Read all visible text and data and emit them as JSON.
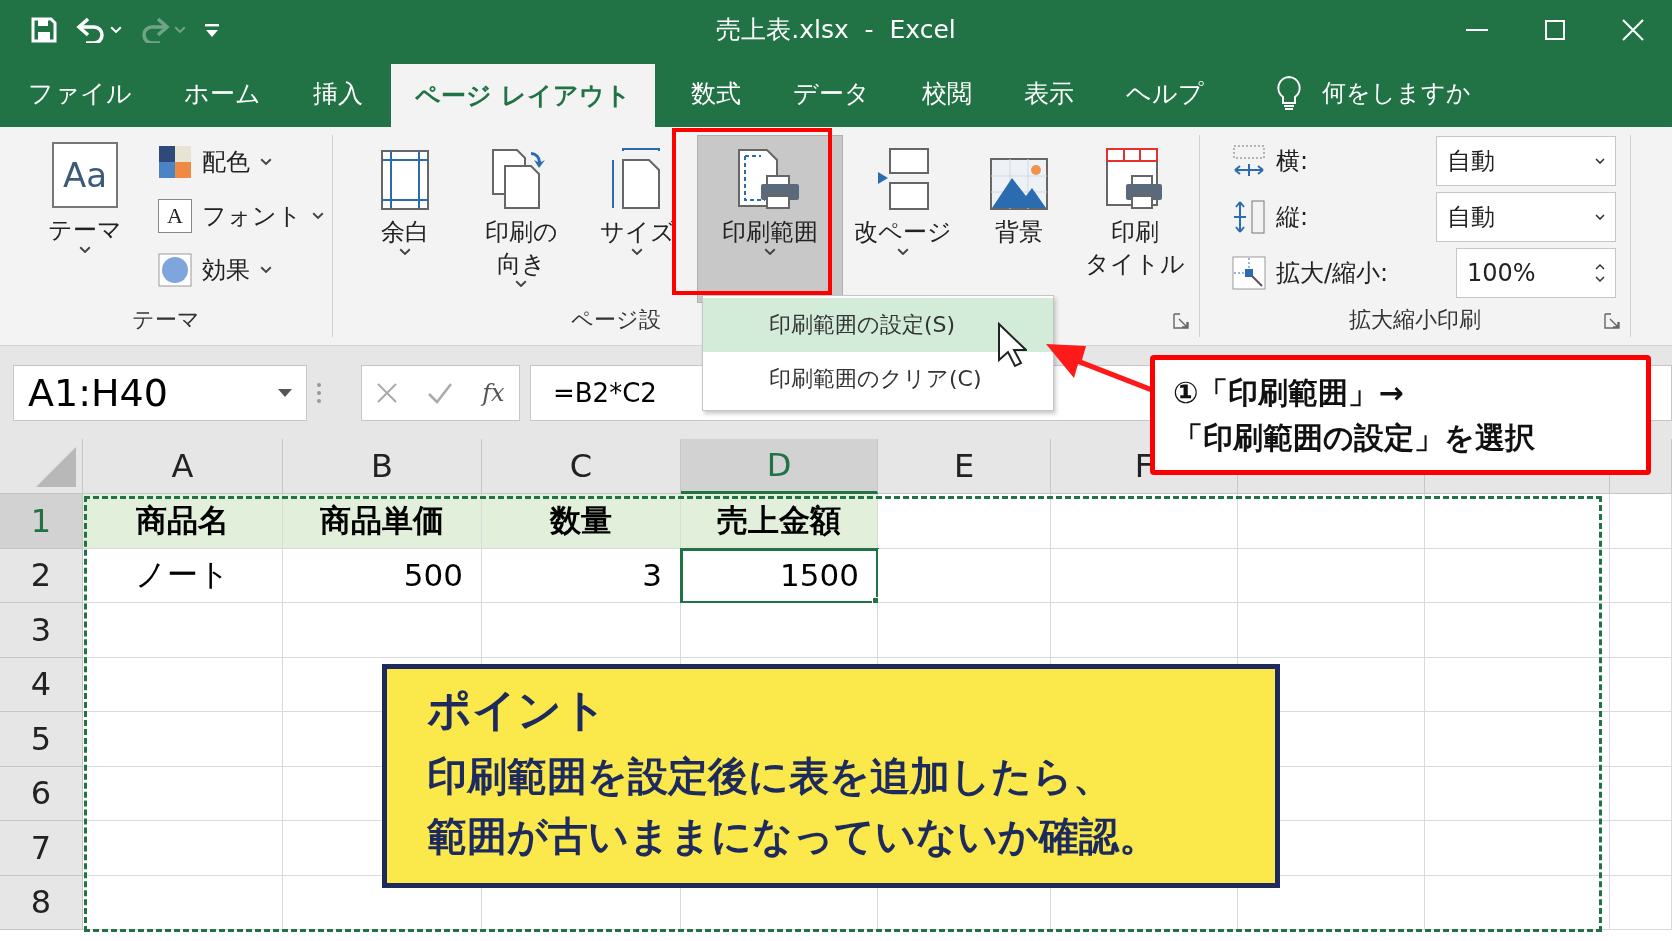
{
  "title_bar": {
    "title": "売上表.xlsx  -  Excel",
    "quick_access": [
      {
        "kind": "save",
        "disabled": false
      },
      {
        "kind": "undo",
        "disabled": false
      },
      {
        "kind": "redo",
        "disabled": true
      },
      {
        "kind": "customize",
        "disabled": false
      }
    ]
  },
  "tabs": [
    {
      "label": "ファイル",
      "selected": false
    },
    {
      "label": "ホーム",
      "selected": false
    },
    {
      "label": "挿入",
      "selected": false
    },
    {
      "label": "ページ レイアウト",
      "selected": true
    },
    {
      "label": "数式",
      "selected": false
    },
    {
      "label": "データ",
      "selected": false
    },
    {
      "label": "校閲",
      "selected": false
    },
    {
      "label": "表示",
      "selected": false
    },
    {
      "label": "ヘルプ",
      "selected": false
    }
  ],
  "tell_me": {
    "placeholder": "何をしますか"
  },
  "ribbon": {
    "theme_group": {
      "label": "テーマ",
      "theme_button": {
        "label": "テーマ",
        "icon_text": "Aa"
      },
      "items": [
        {
          "kind": "colors",
          "label": "配色"
        },
        {
          "kind": "fonts",
          "label": "フォント",
          "icon_text": "A"
        },
        {
          "kind": "effects",
          "label": "効果"
        }
      ]
    },
    "page_setup_group": {
      "label": "ページ設",
      "buttons": [
        {
          "kind": "margins",
          "lines": [
            "余白"
          ],
          "dropdown": true,
          "pressed": false
        },
        {
          "kind": "orientation",
          "lines": [
            "印刷の",
            "向き"
          ],
          "dropdown": true,
          "pressed": false
        },
        {
          "kind": "size",
          "lines": [
            "サイズ"
          ],
          "dropdown": true,
          "pressed": false
        },
        {
          "kind": "print_area",
          "lines": [
            "印刷範囲"
          ],
          "dropdown": true,
          "pressed": true
        },
        {
          "kind": "breaks",
          "lines": [
            "改ページ"
          ],
          "dropdown": true,
          "pressed": false
        },
        {
          "kind": "background",
          "lines": [
            "背景"
          ],
          "dropdown": false,
          "pressed": false
        },
        {
          "kind": "titles",
          "lines": [
            "印刷",
            "タイトル"
          ],
          "dropdown": false,
          "pressed": false
        }
      ]
    },
    "scale_group": {
      "label": "拡大縮小印刷",
      "rows": [
        {
          "kind": "width",
          "label": "横:",
          "value": "自動"
        },
        {
          "kind": "height",
          "label": "縦:",
          "value": "自動"
        },
        {
          "kind": "scale",
          "label": "拡大/縮小:",
          "value": "100%"
        }
      ]
    }
  },
  "print_area_menu": {
    "items": [
      {
        "label": "印刷範囲の設定(S)",
        "highlighted": true
      },
      {
        "label": "印刷範囲のクリア(C)",
        "highlighted": false
      }
    ]
  },
  "formula_bar": {
    "name_box": "A1:H40",
    "function_label": "fx",
    "formula": "=B2*C2"
  },
  "sheet": {
    "columns": [
      {
        "label": "A",
        "selected": false
      },
      {
        "label": "B",
        "selected": false
      },
      {
        "label": "C",
        "selected": false
      },
      {
        "label": "D",
        "selected": true
      },
      {
        "label": "E",
        "selected": false
      },
      {
        "label": "F",
        "selected": false
      },
      {
        "selected": false
      },
      {
        "selected": false
      }
    ],
    "rows": [
      {
        "header": "1",
        "selected": true,
        "cells": [
          {
            "value": "商品名",
            "kind": "heading",
            "active": false
          },
          {
            "value": "商品単価",
            "kind": "heading",
            "active": false
          },
          {
            "value": "数量",
            "kind": "heading",
            "active": false
          },
          {
            "value": "売上金額",
            "kind": "heading",
            "active": false
          }
        ]
      },
      {
        "header": "2",
        "selected": false,
        "cells": [
          {
            "value": "ノート",
            "kind": "text",
            "active": false
          },
          {
            "value": "500",
            "kind": "number",
            "active": false
          },
          {
            "value": "3",
            "kind": "number",
            "active": false
          },
          {
            "value": "1500",
            "kind": "number",
            "active": true
          }
        ]
      },
      {
        "header": "3",
        "selected": false
      },
      {
        "header": "4",
        "selected": false
      },
      {
        "header": "5",
        "selected": false
      },
      {
        "header": "6",
        "selected": false
      },
      {
        "header": "7",
        "selected": false
      },
      {
        "header": "8",
        "selected": false
      }
    ]
  },
  "callout": {
    "text": "①「印刷範囲」→\n「印刷範囲の設定」を選択"
  },
  "point_box": {
    "title": "ポイント",
    "lines": [
      "印刷範囲を設定後に表を追加したら、",
      "範囲が古いままになっていないか確認。"
    ]
  }
}
